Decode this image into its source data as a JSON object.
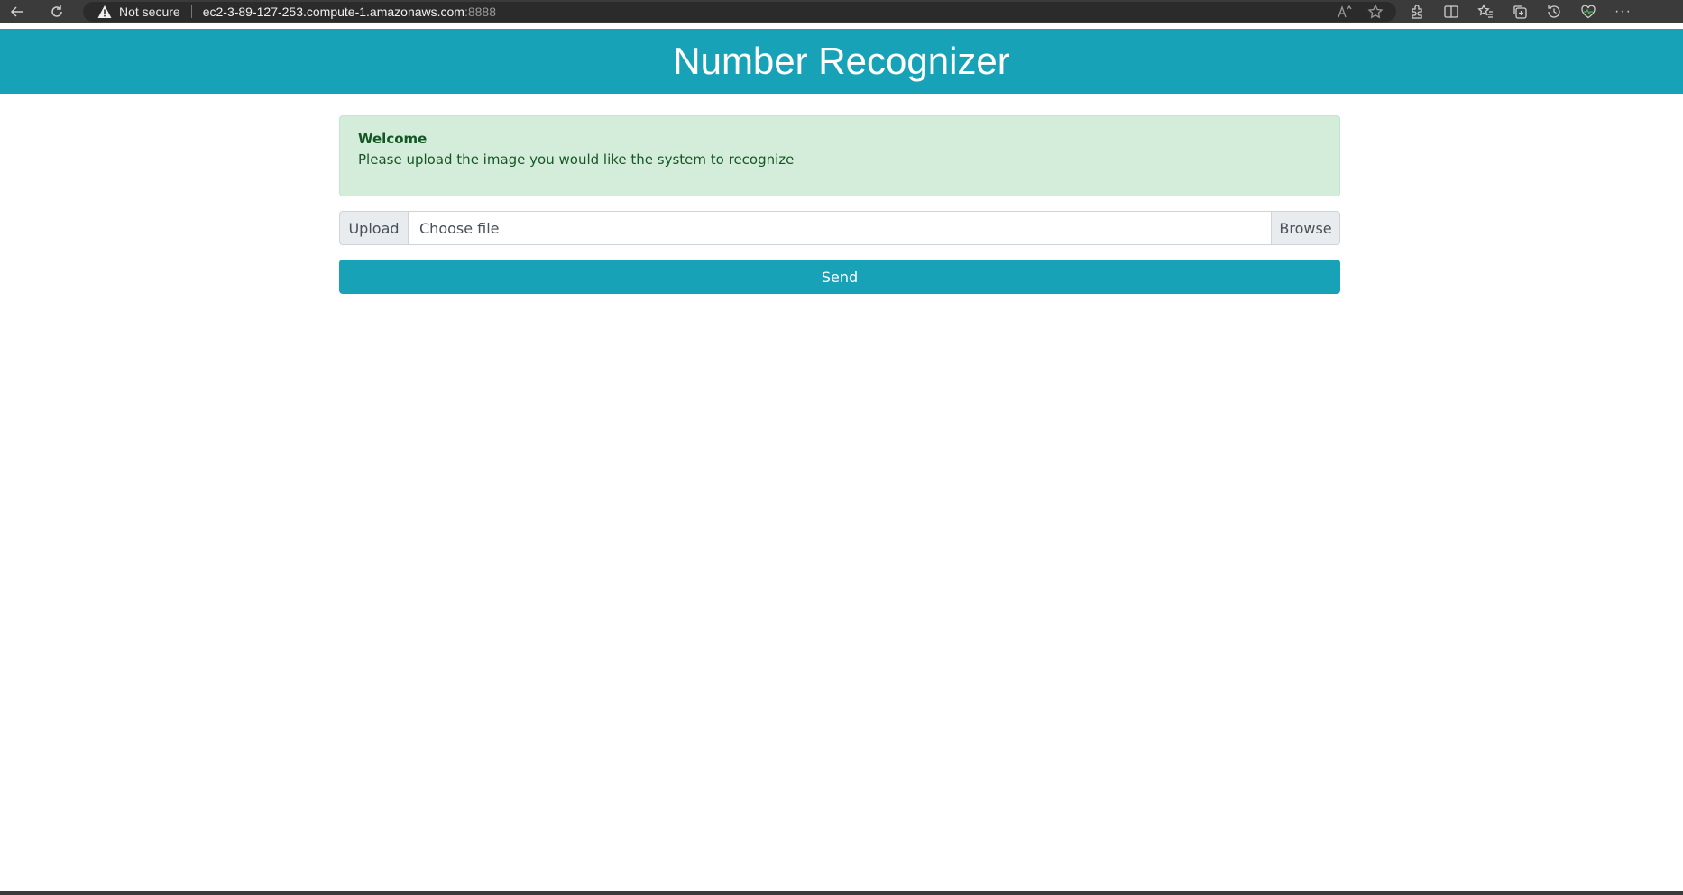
{
  "browser": {
    "security_label": "Not secure",
    "url_host": "ec2-3-89-127-253.compute-1.amazonaws.com",
    "url_port": ":8888",
    "more_label": "···"
  },
  "header": {
    "title": "Number Recognizer",
    "color": "#17a2b8"
  },
  "alert": {
    "heading": "Welcome",
    "message": "Please upload the image you would like the system to recognize"
  },
  "upload": {
    "prepend_label": "Upload",
    "file_placeholder": "Choose file",
    "browse_label": "Browse"
  },
  "send_button": {
    "label": "Send"
  },
  "icons": {
    "back": "back-arrow-icon",
    "refresh": "refresh-icon",
    "warning": "warning-icon",
    "read_aloud": "read-aloud-icon",
    "favorite": "star-icon",
    "extensions": "extensions-icon",
    "split_screen": "split-screen-icon",
    "favorites_list": "favorites-icon",
    "collections": "collections-icon",
    "history": "history-icon",
    "health": "browser-essentials-icon",
    "menu": "more-icon"
  }
}
